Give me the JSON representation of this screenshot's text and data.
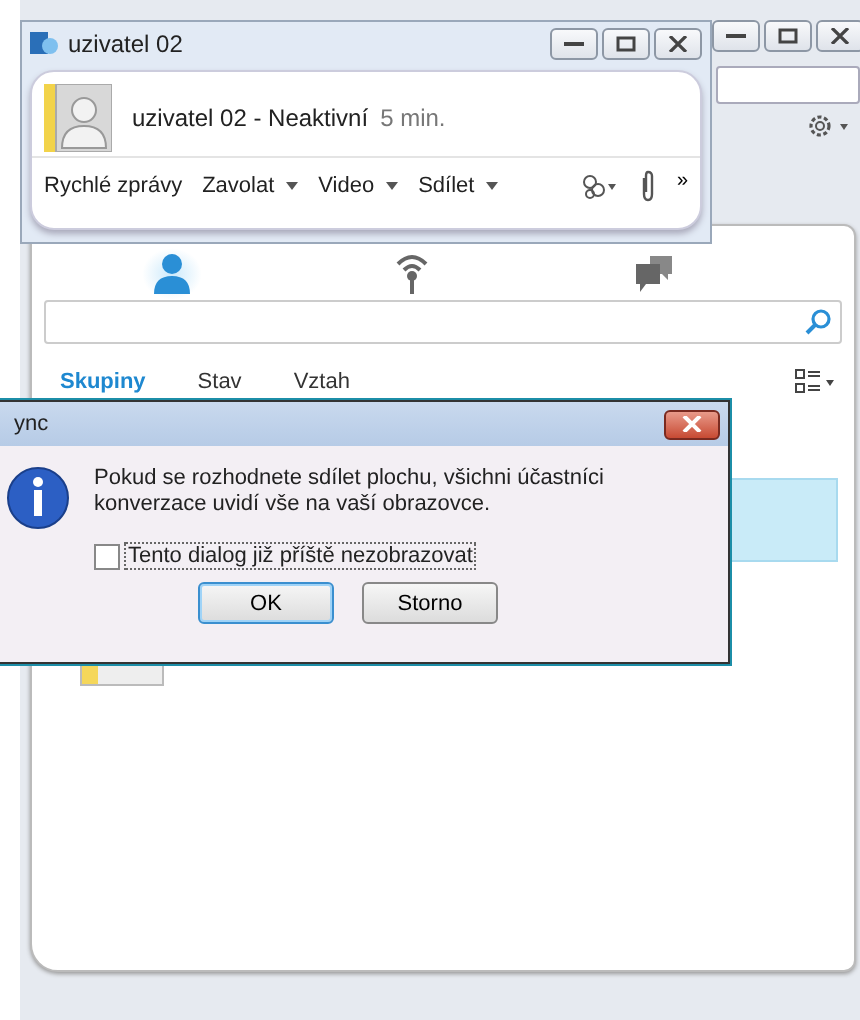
{
  "main_window": {
    "views": [
      {
        "kind": "contacts",
        "selected": true
      },
      {
        "kind": "status",
        "selected": false
      },
      {
        "kind": "conversations",
        "selected": false
      }
    ],
    "tabs": [
      {
        "label": "Skupiny",
        "selected": true
      },
      {
        "label": "Stav",
        "selected": false
      },
      {
        "label": "Vztah",
        "selected": false
      }
    ]
  },
  "conversation_window": {
    "title": "uzivatel 02",
    "contact": {
      "name": "uzivatel 02 - Neaktivní",
      "idle": "5 min."
    },
    "toolbar": [
      {
        "label": "Rychlé zprávy",
        "dropdown": false
      },
      {
        "label": "Zavolat",
        "dropdown": true
      },
      {
        "label": "Video",
        "dropdown": true
      },
      {
        "label": "Sdílet",
        "dropdown": true
      }
    ],
    "more": "»"
  },
  "dialog": {
    "title": "ync",
    "message": "Pokud se rozhodnete sdílet plochu, všichni účastníci konverzace uvidí vše na vaší obrazovce.",
    "checkbox": {
      "label": "Tento dialog již příště nezobrazovat",
      "checked": false
    },
    "buttons": [
      {
        "label": "OK",
        "default": true
      },
      {
        "label": "Storno",
        "default": false
      }
    ]
  }
}
